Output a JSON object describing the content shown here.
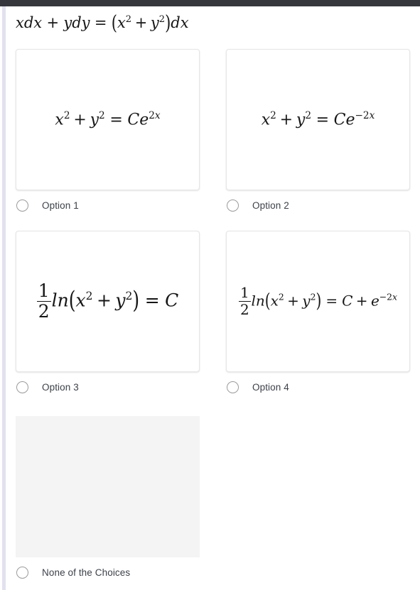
{
  "theme": {
    "top_bar_color": "#35373d",
    "left_strip_color": "#e2e1ee",
    "card_background": "#ffffff",
    "card_border_color": "#e6e6e6",
    "blank_card_background": "#f4f4f4",
    "label_text_color": "#3c4148",
    "radio_border_color": "#9b9b9b",
    "math_text_color": "#161616"
  },
  "question": {
    "equation_text": "xdx + ydy = (x^2 + y^2)dx"
  },
  "options": [
    {
      "id": "option-1",
      "label": "Option 1",
      "equation_text": "x^2 + y^2 = Ce^{2x}",
      "selected": false,
      "blank": false
    },
    {
      "id": "option-2",
      "label": "Option 2",
      "equation_text": "x^2 + y^2 = Ce^{-2x}",
      "selected": false,
      "blank": false
    },
    {
      "id": "option-3",
      "label": "Option 3",
      "equation_text": "1/2 ln(x^2 + y^2) = C",
      "selected": false,
      "blank": false
    },
    {
      "id": "option-4",
      "label": "Option 4",
      "equation_text": "1/2 ln(x^2 + y^2) = C + e^{-2x}",
      "selected": false,
      "blank": false
    },
    {
      "id": "option-none",
      "label": "None of the Choices",
      "equation_text": "",
      "selected": false,
      "blank": true
    }
  ]
}
